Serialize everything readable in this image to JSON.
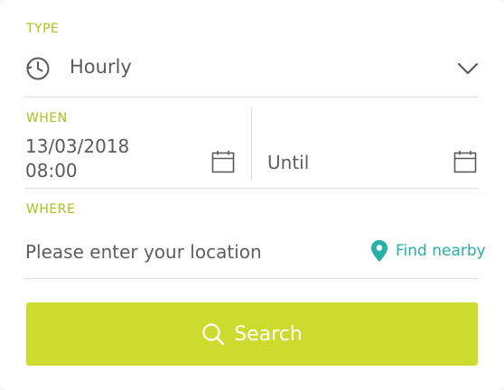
{
  "form": {
    "type": {
      "label": "TYPE",
      "value": "Hourly",
      "icon": "clock-icon",
      "chevron_icon": "chevron-down-icon"
    },
    "when": {
      "label": "WHEN",
      "start_date": "13/03/2018",
      "start_time": "08:00",
      "until_placeholder": "Until",
      "calendar_icon": "calendar-icon"
    },
    "where": {
      "label": "WHERE",
      "placeholder": "Please enter your location",
      "find_nearby_label": "Find nearby",
      "pin_icon": "location-pin-icon"
    },
    "search_button": {
      "label": "Search",
      "icon": "search-icon"
    }
  },
  "colors": {
    "accent_lime": "#cddb2e",
    "label_green": "#a8c31c",
    "teal": "#26b1a6",
    "text_gray": "#5a5a5a",
    "divider": "#dddddd"
  }
}
